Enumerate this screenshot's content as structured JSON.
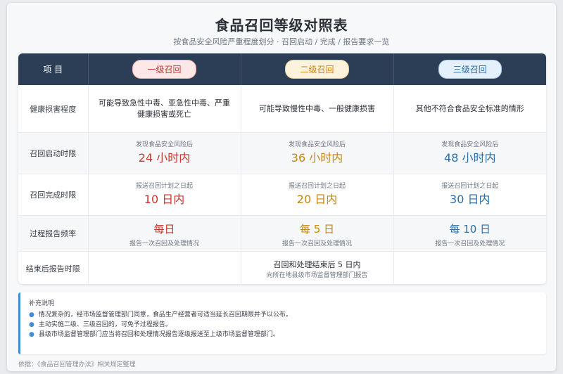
{
  "header": {
    "title": "食品召回等级对照表",
    "subtitle": "按食品安全风险严重程度划分 · 召回启动 / 完成 / 报告要求一览"
  },
  "table": {
    "head_label": "项 目",
    "levels": [
      "一级召回",
      "二级召回",
      "三级召回"
    ],
    "health": {
      "label": "健康损害程度",
      "values": [
        "可能导致急性中毒、亚急性中毒、严重健康损害或死亡",
        "可能导致慢性中毒、一般健康损害",
        "其他不符合食品安全标准的情形"
      ]
    },
    "start": {
      "label": "召回启动时限",
      "note": "发现食品安全风险后",
      "values": [
        "24 小时内",
        "36 小时内",
        "48 小时内"
      ]
    },
    "complete": {
      "label": "召回完成时限",
      "note": "报送召回计划之日起",
      "values": [
        "10 日内",
        "20 日内",
        "30 日内"
      ]
    },
    "report": {
      "label": "过程报告频率",
      "values": [
        "每日",
        "每 5 日",
        "每 10 日"
      ],
      "note": "报告一次召回及处理情况"
    },
    "closing": {
      "label": "结束后报告时限",
      "main": "召回和处理结束后 5 日内",
      "note": "向所在地县级市场监督管理部门报告"
    }
  },
  "notes": {
    "title": "补充说明",
    "items": [
      "情况复杂的，经市场监督管理部门同意，食品生产经营者可适当延长召回期限并予以公布。",
      "主动实施二级、三级召回的，可免予过程报告。",
      "县级市场监督管理部门应当将召回和处理情况报告逐级报送至上级市场监督管理部门。"
    ]
  },
  "source": "依据：《食品召回管理办法》相关规定整理",
  "colors": {
    "level1": "#c7372f",
    "level2": "#c98511",
    "level3": "#2a6ea8",
    "header_bg": "#2c3e55",
    "accent": "#3f8ed8"
  }
}
